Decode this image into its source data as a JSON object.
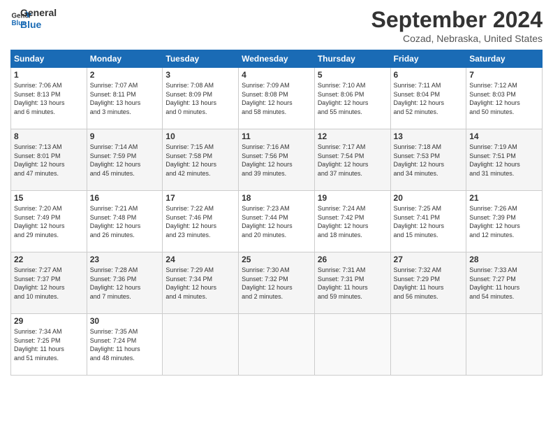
{
  "logo": {
    "line1": "General",
    "line2": "Blue"
  },
  "header": {
    "month": "September 2024",
    "location": "Cozad, Nebraska, United States"
  },
  "weekdays": [
    "Sunday",
    "Monday",
    "Tuesday",
    "Wednesday",
    "Thursday",
    "Friday",
    "Saturday"
  ],
  "weeks": [
    [
      {
        "day": "1",
        "info": "Sunrise: 7:06 AM\nSunset: 8:13 PM\nDaylight: 13 hours\nand 6 minutes."
      },
      {
        "day": "2",
        "info": "Sunrise: 7:07 AM\nSunset: 8:11 PM\nDaylight: 13 hours\nand 3 minutes."
      },
      {
        "day": "3",
        "info": "Sunrise: 7:08 AM\nSunset: 8:09 PM\nDaylight: 13 hours\nand 0 minutes."
      },
      {
        "day": "4",
        "info": "Sunrise: 7:09 AM\nSunset: 8:08 PM\nDaylight: 12 hours\nand 58 minutes."
      },
      {
        "day": "5",
        "info": "Sunrise: 7:10 AM\nSunset: 8:06 PM\nDaylight: 12 hours\nand 55 minutes."
      },
      {
        "day": "6",
        "info": "Sunrise: 7:11 AM\nSunset: 8:04 PM\nDaylight: 12 hours\nand 52 minutes."
      },
      {
        "day": "7",
        "info": "Sunrise: 7:12 AM\nSunset: 8:03 PM\nDaylight: 12 hours\nand 50 minutes."
      }
    ],
    [
      {
        "day": "8",
        "info": "Sunrise: 7:13 AM\nSunset: 8:01 PM\nDaylight: 12 hours\nand 47 minutes."
      },
      {
        "day": "9",
        "info": "Sunrise: 7:14 AM\nSunset: 7:59 PM\nDaylight: 12 hours\nand 45 minutes."
      },
      {
        "day": "10",
        "info": "Sunrise: 7:15 AM\nSunset: 7:58 PM\nDaylight: 12 hours\nand 42 minutes."
      },
      {
        "day": "11",
        "info": "Sunrise: 7:16 AM\nSunset: 7:56 PM\nDaylight: 12 hours\nand 39 minutes."
      },
      {
        "day": "12",
        "info": "Sunrise: 7:17 AM\nSunset: 7:54 PM\nDaylight: 12 hours\nand 37 minutes."
      },
      {
        "day": "13",
        "info": "Sunrise: 7:18 AM\nSunset: 7:53 PM\nDaylight: 12 hours\nand 34 minutes."
      },
      {
        "day": "14",
        "info": "Sunrise: 7:19 AM\nSunset: 7:51 PM\nDaylight: 12 hours\nand 31 minutes."
      }
    ],
    [
      {
        "day": "15",
        "info": "Sunrise: 7:20 AM\nSunset: 7:49 PM\nDaylight: 12 hours\nand 29 minutes."
      },
      {
        "day": "16",
        "info": "Sunrise: 7:21 AM\nSunset: 7:48 PM\nDaylight: 12 hours\nand 26 minutes."
      },
      {
        "day": "17",
        "info": "Sunrise: 7:22 AM\nSunset: 7:46 PM\nDaylight: 12 hours\nand 23 minutes."
      },
      {
        "day": "18",
        "info": "Sunrise: 7:23 AM\nSunset: 7:44 PM\nDaylight: 12 hours\nand 20 minutes."
      },
      {
        "day": "19",
        "info": "Sunrise: 7:24 AM\nSunset: 7:42 PM\nDaylight: 12 hours\nand 18 minutes."
      },
      {
        "day": "20",
        "info": "Sunrise: 7:25 AM\nSunset: 7:41 PM\nDaylight: 12 hours\nand 15 minutes."
      },
      {
        "day": "21",
        "info": "Sunrise: 7:26 AM\nSunset: 7:39 PM\nDaylight: 12 hours\nand 12 minutes."
      }
    ],
    [
      {
        "day": "22",
        "info": "Sunrise: 7:27 AM\nSunset: 7:37 PM\nDaylight: 12 hours\nand 10 minutes."
      },
      {
        "day": "23",
        "info": "Sunrise: 7:28 AM\nSunset: 7:36 PM\nDaylight: 12 hours\nand 7 minutes."
      },
      {
        "day": "24",
        "info": "Sunrise: 7:29 AM\nSunset: 7:34 PM\nDaylight: 12 hours\nand 4 minutes."
      },
      {
        "day": "25",
        "info": "Sunrise: 7:30 AM\nSunset: 7:32 PM\nDaylight: 12 hours\nand 2 minutes."
      },
      {
        "day": "26",
        "info": "Sunrise: 7:31 AM\nSunset: 7:31 PM\nDaylight: 11 hours\nand 59 minutes."
      },
      {
        "day": "27",
        "info": "Sunrise: 7:32 AM\nSunset: 7:29 PM\nDaylight: 11 hours\nand 56 minutes."
      },
      {
        "day": "28",
        "info": "Sunrise: 7:33 AM\nSunset: 7:27 PM\nDaylight: 11 hours\nand 54 minutes."
      }
    ],
    [
      {
        "day": "29",
        "info": "Sunrise: 7:34 AM\nSunset: 7:25 PM\nDaylight: 11 hours\nand 51 minutes."
      },
      {
        "day": "30",
        "info": "Sunrise: 7:35 AM\nSunset: 7:24 PM\nDaylight: 11 hours\nand 48 minutes."
      },
      {
        "day": "",
        "info": ""
      },
      {
        "day": "",
        "info": ""
      },
      {
        "day": "",
        "info": ""
      },
      {
        "day": "",
        "info": ""
      },
      {
        "day": "",
        "info": ""
      }
    ]
  ]
}
